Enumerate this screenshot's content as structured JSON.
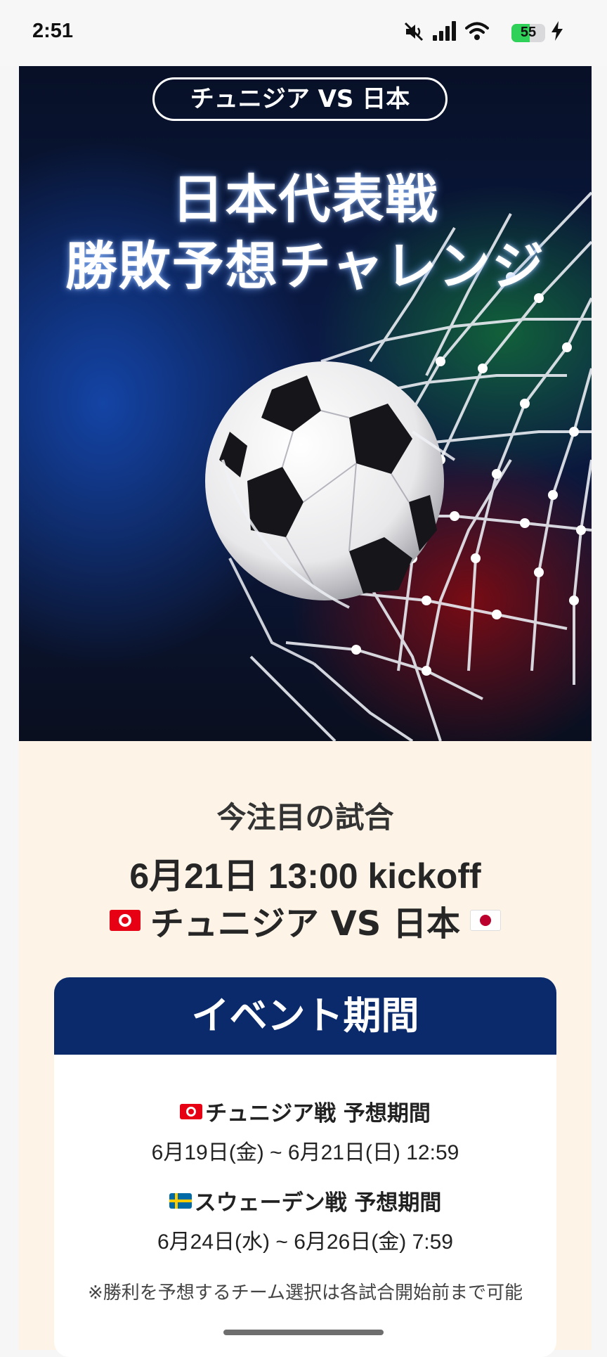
{
  "status_bar": {
    "time": "2:51",
    "battery_level": 55,
    "battery_text": "55",
    "icons": [
      "mute-icon",
      "signal-icon",
      "wifi-icon",
      "battery-icon",
      "charging-bolt-icon"
    ]
  },
  "hero": {
    "match_pill": "チュニジア VS 日本",
    "title_line1": "日本代表戦",
    "title_line2": "勝敗予想チャレンジ",
    "image": "soccer-ball-in-net"
  },
  "feature": {
    "heading": "今注目の試合",
    "kickoff": "6月21日 13:00 kickoff",
    "matchup": "チュニジア VS 日本",
    "home_flag": "tunisia-flag-icon",
    "away_flag": "japan-flag-icon"
  },
  "event": {
    "header": "イベント期間",
    "periods": [
      {
        "flag": "tunisia-flag-icon",
        "title": "チュニジア戦 予想期間",
        "range": "6月19日(金) ~ 6月21日(日) 12:59"
      },
      {
        "flag": "sweden-flag-icon",
        "title": "スウェーデン戦 予想期間",
        "range": "6月24日(水) ~ 6月26日(金) 7:59"
      }
    ],
    "note": "※勝利を予想するチーム選択は各試合開始前まで可能"
  },
  "colors": {
    "accent_navy": "#0b2a6b",
    "page_background": "#fdf4e7",
    "battery_green": "#30d158"
  }
}
